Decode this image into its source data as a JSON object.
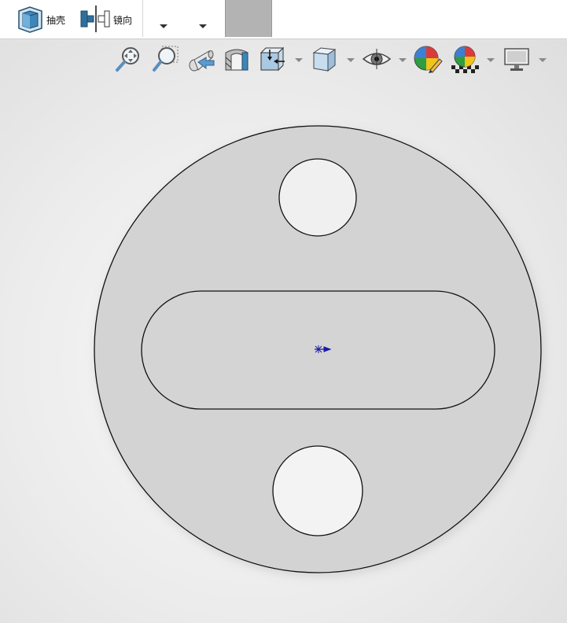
{
  "toolbar": {
    "shell_label": "抽壳",
    "mirror_label": "镜向"
  },
  "hud": {
    "icons": [
      "zoom-to-fit-icon",
      "zoom-to-area-icon",
      "previous-view-icon",
      "section-view-icon",
      "view-orientation-icon",
      "display-style-icon",
      "hide-show-items-icon",
      "edit-appearance-icon",
      "apply-scene-icon",
      "view-settings-icon"
    ]
  },
  "colors": {
    "viewport_bg": "#ececec",
    "part_face": "#d3d3d3",
    "edge": "#111111",
    "origin": "#1a1aa6",
    "tab_gray": "#b3b3b3"
  }
}
